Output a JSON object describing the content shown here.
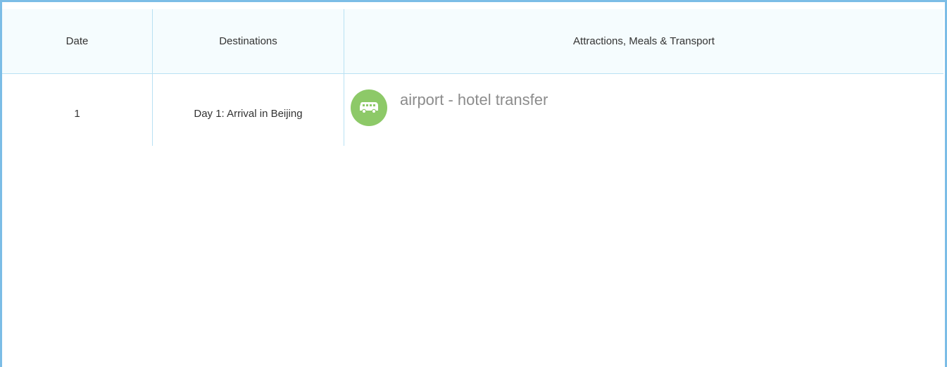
{
  "table": {
    "headers": {
      "date": "Date",
      "destinations": "Destinations",
      "attractions": "Attractions, Meals & Transport"
    },
    "rows": [
      {
        "date": "1",
        "destination": "Day 1: Arrival in Beijing",
        "items": [
          {
            "icon": "bus-icon",
            "text": "airport - hotel transfer"
          }
        ]
      }
    ]
  },
  "colors": {
    "border": "#7cbde6",
    "header_bg": "#f5fcfe",
    "divider": "#b9e1f3",
    "icon_bg": "#8dc968"
  }
}
